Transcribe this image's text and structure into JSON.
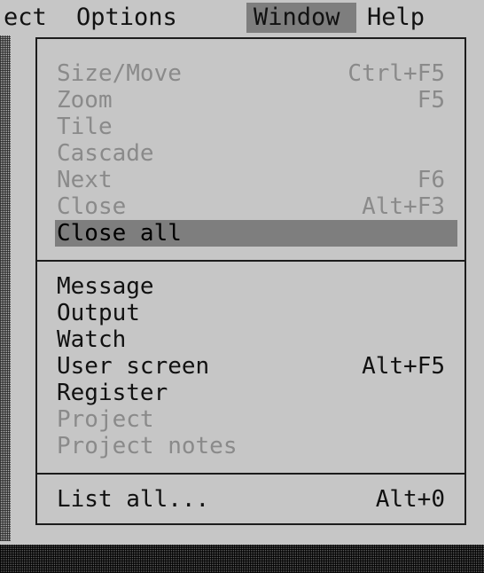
{
  "menubar": {
    "edge_text": "ect",
    "options": "Options",
    "window": "Window",
    "help": "Help"
  },
  "window_menu": {
    "group1": [
      {
        "label": "Size/Move",
        "shortcut": "Ctrl+F5",
        "enabled": false
      },
      {
        "label": "Zoom",
        "shortcut": "F5",
        "enabled": false
      },
      {
        "label": "Tile",
        "shortcut": "",
        "enabled": false
      },
      {
        "label": "Cascade",
        "shortcut": "",
        "enabled": false
      },
      {
        "label": "Next",
        "shortcut": "F6",
        "enabled": false
      },
      {
        "label": "Close",
        "shortcut": "Alt+F3",
        "enabled": false
      },
      {
        "label": "Close all",
        "shortcut": "",
        "enabled": true,
        "selected": true
      }
    ],
    "group2": [
      {
        "label": "Message",
        "shortcut": "",
        "enabled": true
      },
      {
        "label": "Output",
        "shortcut": "",
        "enabled": true
      },
      {
        "label": "Watch",
        "shortcut": "",
        "enabled": true
      },
      {
        "label": "User screen",
        "shortcut": "Alt+F5",
        "enabled": true
      },
      {
        "label": "Register",
        "shortcut": "",
        "enabled": true
      },
      {
        "label": "Project",
        "shortcut": "",
        "enabled": false
      },
      {
        "label": "Project notes",
        "shortcut": "",
        "enabled": false
      }
    ],
    "group3": [
      {
        "label": "List all...",
        "shortcut": "Alt+0",
        "enabled": true
      }
    ]
  },
  "colors": {
    "menu_bg": "#c6c6c6",
    "highlight": "#7e7e7e",
    "text": "#111111",
    "disabled_text": "#8a8a8a",
    "frame": "#1c1c1c"
  }
}
